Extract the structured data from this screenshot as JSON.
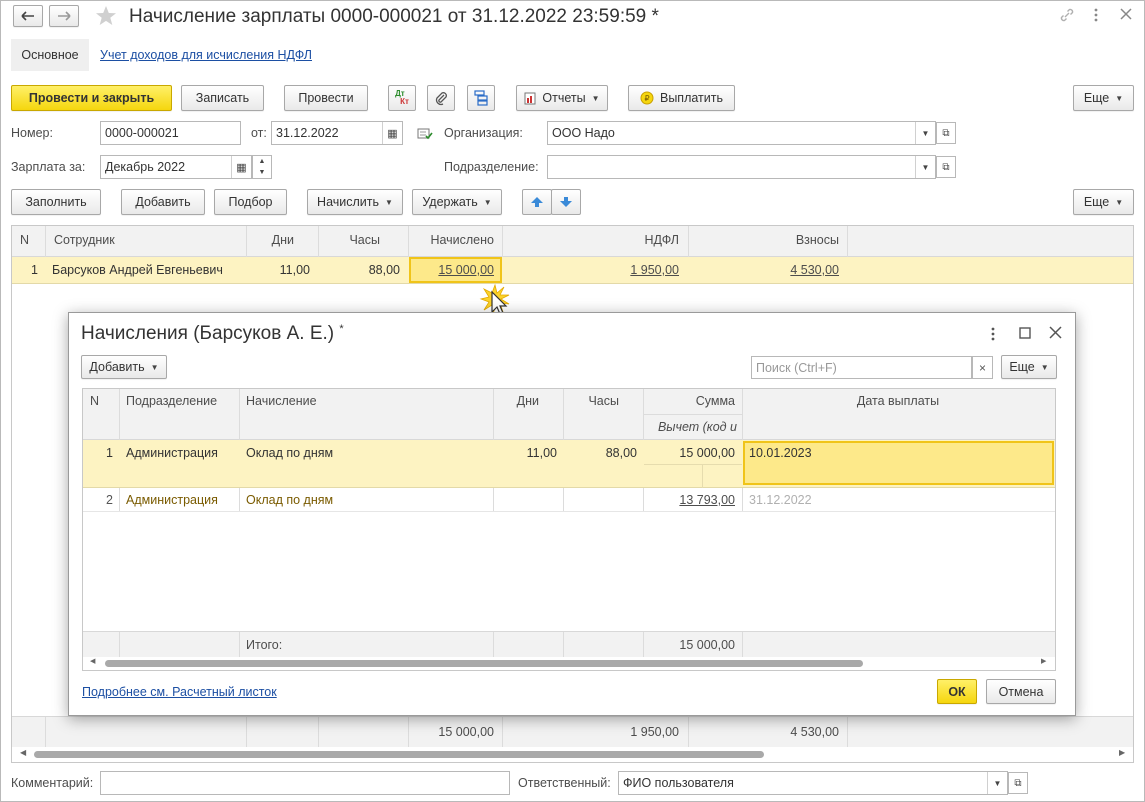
{
  "window": {
    "title": "Начисление зарплаты 0000-000021 от 31.12.2022 23:59:59 *",
    "tabs": [
      {
        "label": "Основное"
      },
      {
        "label": "Учет доходов для исчисления НДФЛ"
      }
    ]
  },
  "toolbar": {
    "post_close": "Провести и закрыть",
    "save": "Записать",
    "post": "Провести",
    "dtkt_top": "Дт",
    "dtkt_bottom": "Кт",
    "reports": "Отчеты",
    "pay": "Выплатить",
    "more": "Еще"
  },
  "form": {
    "number_label": "Номер:",
    "number_value": "0000-000021",
    "date_label": "от:",
    "date_value": "31.12.2022",
    "org_label": "Организация:",
    "org_value": "ООО Надо",
    "salary_label": "Зарплата за:",
    "salary_value": "Декабрь 2022",
    "division_label": "Подразделение:",
    "division_value": ""
  },
  "table_toolbar": {
    "fill": "Заполнить",
    "add": "Добавить",
    "select": "Подбор",
    "accrue": "Начислить",
    "withhold": "Удержать",
    "more": "Еще"
  },
  "main_table": {
    "headers": [
      "N",
      "Сотрудник",
      "Дни",
      "Часы",
      "Начислено",
      "НДФЛ",
      "Взносы"
    ],
    "rows": [
      {
        "n": "1",
        "employee": "Барсуков Андрей Евгеньевич",
        "days": "11,00",
        "hours": "88,00",
        "accrued": "15 000,00",
        "ndfl": "1 950,00",
        "contrib": "4 530,00"
      }
    ],
    "totals": {
      "accrued": "15 000,00",
      "ndfl": "1 950,00",
      "contrib": "4 530,00"
    }
  },
  "dialog": {
    "title": "Начисления (Барсуков А. Е.)",
    "title_mark": "*",
    "add": "Добавить",
    "search_placeholder": "Поиск (Ctrl+F)",
    "search_clear": "×",
    "more": "Еще",
    "headers": {
      "n": "N",
      "division": "Подразделение",
      "accrual": "Начисление",
      "days": "Дни",
      "hours": "Часы",
      "sum": "Сумма",
      "sum_sub": "Вычет (код и",
      "pay_date": "Дата выплаты"
    },
    "rows": [
      {
        "n": "1",
        "division": "Администрация",
        "accrual": "Оклад по дням",
        "days": "11,00",
        "hours": "88,00",
        "sum": "15 000,00",
        "pay_date": "10.01.2023"
      },
      {
        "n": "2",
        "division": "Администрация",
        "accrual": "Оклад по дням",
        "days": "",
        "hours": "",
        "sum": "13 793,00",
        "pay_date": "31.12.2022"
      }
    ],
    "total_label": "Итого:",
    "total_sum": "15 000,00",
    "details_link": "Подробнее см. Расчетный листок",
    "ok": "ОК",
    "cancel": "Отмена"
  },
  "footer": {
    "comment_label": "Комментарий:",
    "comment_value": "",
    "responsible_label": "Ответственный:",
    "responsible_value": "ФИО пользователя"
  },
  "colors": {
    "accent_yellow": "#f5d60e",
    "selected_row": "#fdf3c2",
    "link_blue": "#1c4fa3",
    "header_gray": "#f2f2f2",
    "muted_brown": "#7a5b00"
  }
}
